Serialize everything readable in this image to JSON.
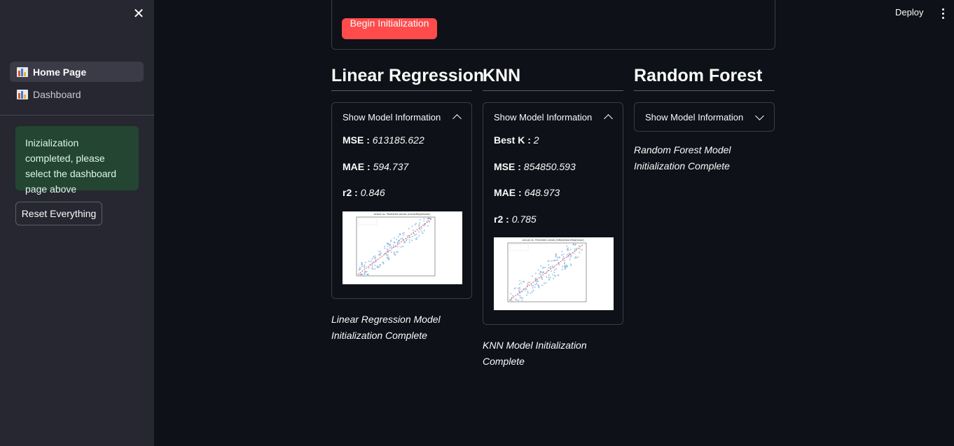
{
  "sidebar": {
    "nav_items": [
      {
        "label": "Home Page",
        "active": true
      },
      {
        "label": "Dashboard",
        "active": false
      }
    ],
    "success_message": "Inizialization completed, please select the dashboard page above",
    "reset_button": "Reset Everything"
  },
  "toolbar": {
    "deploy": "Deploy"
  },
  "main": {
    "begin_button": "Begin Initialization",
    "models": [
      {
        "title": "Linear Regression",
        "expander_label": "Show Model Information",
        "expanded": true,
        "metrics": [
          {
            "label": "MSE :",
            "value": "613185.622"
          },
          {
            "label": "MAE :",
            "value": "594.737"
          },
          {
            "label": "r2 :",
            "value": "0.846"
          }
        ],
        "plot_title": "Actual vs. Predicted values (LinearRegression)",
        "caption": "Linear Regression Model Initialization Complete"
      },
      {
        "title": "KNN",
        "expander_label": "Show Model Information",
        "expanded": true,
        "metrics": [
          {
            "label": "Best K :",
            "value": "2"
          },
          {
            "label": "MSE :",
            "value": "854850.593"
          },
          {
            "label": "MAE :",
            "value": "648.973"
          },
          {
            "label": "r2 :",
            "value": "0.785"
          }
        ],
        "plot_title": "Actual vs. Predicted values (KNeighborsRegressor)",
        "caption": "KNN Model Initialization Complete"
      },
      {
        "title": "Random Forest",
        "expander_label": "Show Model Information",
        "expanded": false,
        "caption": "Random Forest Model Initialization Complete"
      }
    ]
  }
}
